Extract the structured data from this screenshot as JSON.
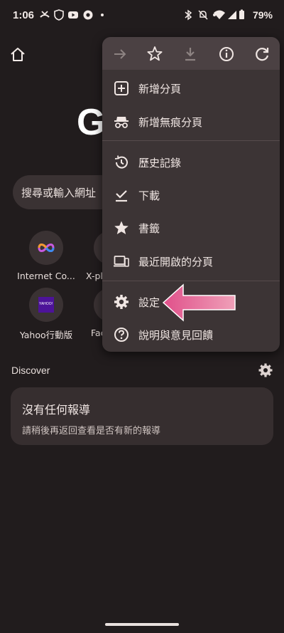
{
  "status_bar": {
    "time": "1:06",
    "battery": "79%"
  },
  "newtab": {
    "search_placeholder": "搜尋或輸入網址",
    "shortcuts": [
      {
        "label": "Internet Co..."
      },
      {
        "label": "X-plo..."
      },
      {
        "label": "Yahoo行動版"
      },
      {
        "label": "Fac..."
      }
    ],
    "yahoo_logo_text": "YAHOO!",
    "discover_label": "Discover",
    "card_title": "沒有任何報導",
    "card_subtitle": "請稍後再返回查看是否有新的報導"
  },
  "menu": {
    "toolbar_icons": [
      "forward-icon",
      "bookmark-star-icon",
      "download-icon",
      "info-icon",
      "refresh-icon"
    ],
    "items": [
      {
        "label": "新增分頁",
        "icon": "new-tab-icon"
      },
      {
        "label": "新增無痕分頁",
        "icon": "incognito-icon"
      },
      {
        "label": "歷史記錄",
        "icon": "history-icon"
      },
      {
        "label": "下載",
        "icon": "downloads-icon"
      },
      {
        "label": "書籤",
        "icon": "bookmarks-icon"
      },
      {
        "label": "最近開啟的分頁",
        "icon": "recent-tabs-icon"
      },
      {
        "label": "設定",
        "icon": "settings-icon"
      },
      {
        "label": "說明與意見回饋",
        "icon": "help-icon"
      }
    ]
  },
  "colors": {
    "background": "#211c1d",
    "menu": "#3c3435",
    "menu_toolbar": "#4b4143",
    "arrow": "#e0618f"
  }
}
